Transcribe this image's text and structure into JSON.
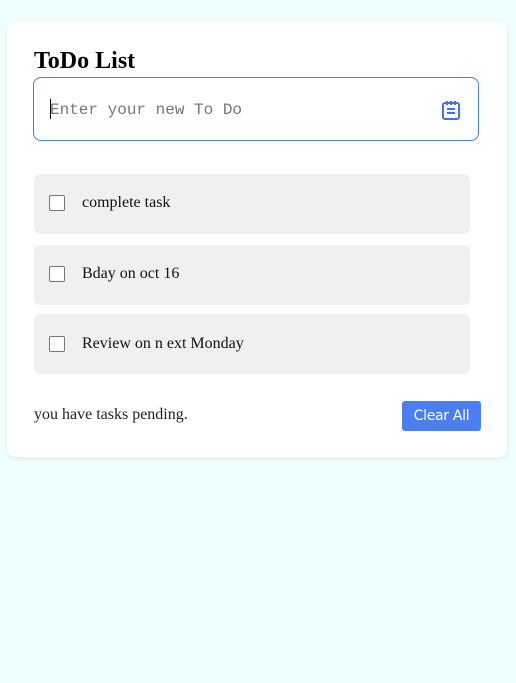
{
  "app": {
    "title": "ToDo List"
  },
  "input": {
    "placeholder": "Enter your new To Do",
    "value": ""
  },
  "icons": {
    "save": "notepad-icon",
    "accent": "#4a7ff0"
  },
  "todos": [
    {
      "text": "complete task",
      "checked": false
    },
    {
      "text": "Bday on oct 16",
      "checked": false
    },
    {
      "text": "Review on n ext Monday",
      "checked": false
    }
  ],
  "footer": {
    "pending_text": "you have tasks pending.",
    "clear_label": "Clear All"
  }
}
